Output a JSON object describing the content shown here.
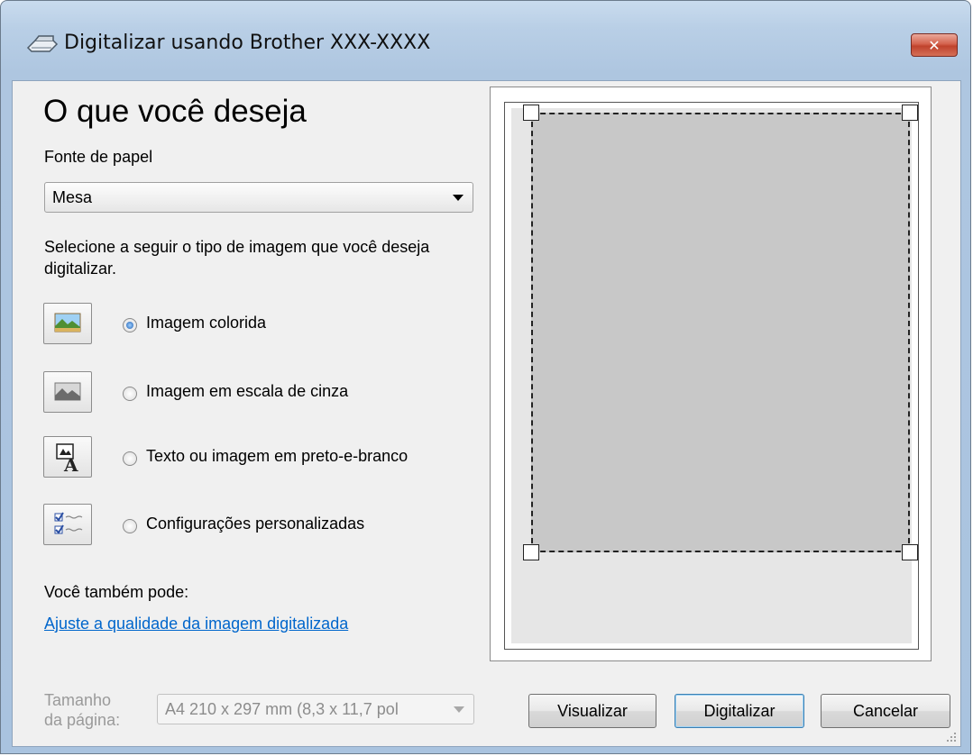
{
  "window": {
    "title": "Digitalizar usando Brother  XXX-XXXX",
    "close_symbol": "✕"
  },
  "main": {
    "heading": "O que você deseja",
    "paper_source_label": "Fonte de papel",
    "paper_source_value": "Mesa",
    "description": "Selecione a seguir o tipo de imagem que você deseja digitalizar.",
    "image_types": [
      {
        "label": "Imagem colorida",
        "selected": true,
        "icon": "color-photo-icon"
      },
      {
        "label": "Imagem em escala de cinza",
        "selected": false,
        "icon": "grayscale-photo-icon"
      },
      {
        "label": "Texto ou imagem em preto-e-branco",
        "selected": false,
        "icon": "text-image-icon"
      },
      {
        "label": "Configurações personalizadas",
        "selected": false,
        "icon": "custom-settings-icon"
      }
    ],
    "also_label": "Você também pode:",
    "adjust_link": "Ajuste a qualidade da imagem digitalizada",
    "page_size_label_line1": "Tamanho",
    "page_size_label_line2": "da página:",
    "page_size_value": "A4 210 x 297 mm (8,3 x 11,7 pol"
  },
  "buttons": {
    "preview": "Visualizar",
    "scan": "Digitalizar",
    "cancel": "Cancelar"
  },
  "colors": {
    "link": "#0066cc",
    "scan_area": "#c8c8c8",
    "close_button": "#c0432d"
  }
}
